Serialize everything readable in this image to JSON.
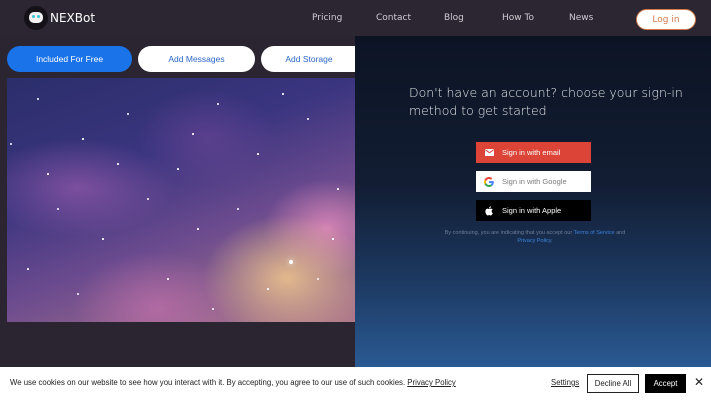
{
  "header": {
    "brand": "NEXBot",
    "nav": [
      "Pricing",
      "Contact",
      "Blog",
      "How To",
      "News"
    ],
    "login_label": "Log in"
  },
  "tabs": [
    {
      "label": "Included For Free",
      "active": true
    },
    {
      "label": "Add Messages",
      "active": false
    },
    {
      "label": "Add Storage",
      "active": false
    }
  ],
  "signin": {
    "heading": "Don't have an account? choose your sign-in method to get started",
    "email_label": "Sign in with email",
    "google_label": "Sign in with Google",
    "apple_label": "Sign in with Apple",
    "terms_prefix": "By continuing, you are indicating that you accept our",
    "terms_link": "Terms of Service",
    "terms_and": "and",
    "privacy_link": "Privacy Policy",
    "terms_suffix": "."
  },
  "cookie": {
    "text": "We use cookies on our website to see how you interact with it. By accepting, you agree to our use of such cookies.",
    "privacy_link": "Privacy Policy",
    "settings_label": "Settings",
    "decline_label": "Decline All",
    "accept_label": "Accept",
    "close_icon": "close-icon"
  },
  "colors": {
    "accent": "#1a73e8",
    "login_border": "#d47a4a",
    "email_button": "#db4437",
    "apple_button": "#000000"
  }
}
